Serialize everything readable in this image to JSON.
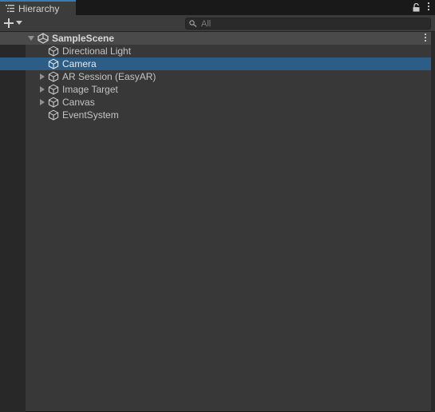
{
  "window": {
    "tab_title": "Hierarchy",
    "icons": [
      "list-icon",
      "lock-icon",
      "kebab-menu-icon"
    ]
  },
  "toolbar": {
    "create_icon": "plus-icon",
    "dropdown_icon": "chevron-down-icon",
    "search": {
      "placeholder": "All",
      "icon": "search-icon"
    }
  },
  "hierarchy": {
    "scene": {
      "name": "SampleScene",
      "expanded": true,
      "icon": "unity-scene-icon"
    },
    "items": [
      {
        "label": "Directional Light",
        "has_children": false,
        "selected": false,
        "icon": "gameobject-cube-icon"
      },
      {
        "label": "Camera",
        "has_children": false,
        "selected": true,
        "icon": "gameobject-cube-icon"
      },
      {
        "label": "AR Session (EasyAR)",
        "has_children": true,
        "selected": false,
        "icon": "gameobject-cube-icon"
      },
      {
        "label": "Image Target",
        "has_children": true,
        "selected": false,
        "icon": "gameobject-cube-icon"
      },
      {
        "label": "Canvas",
        "has_children": true,
        "selected": false,
        "icon": "gameobject-cube-icon"
      },
      {
        "label": "EventSystem",
        "has_children": false,
        "selected": false,
        "icon": "gameobject-cube-icon"
      }
    ]
  },
  "colors": {
    "selection": "#2c5d87",
    "tab_accent": "#3a79bb",
    "panel": "#383838"
  }
}
